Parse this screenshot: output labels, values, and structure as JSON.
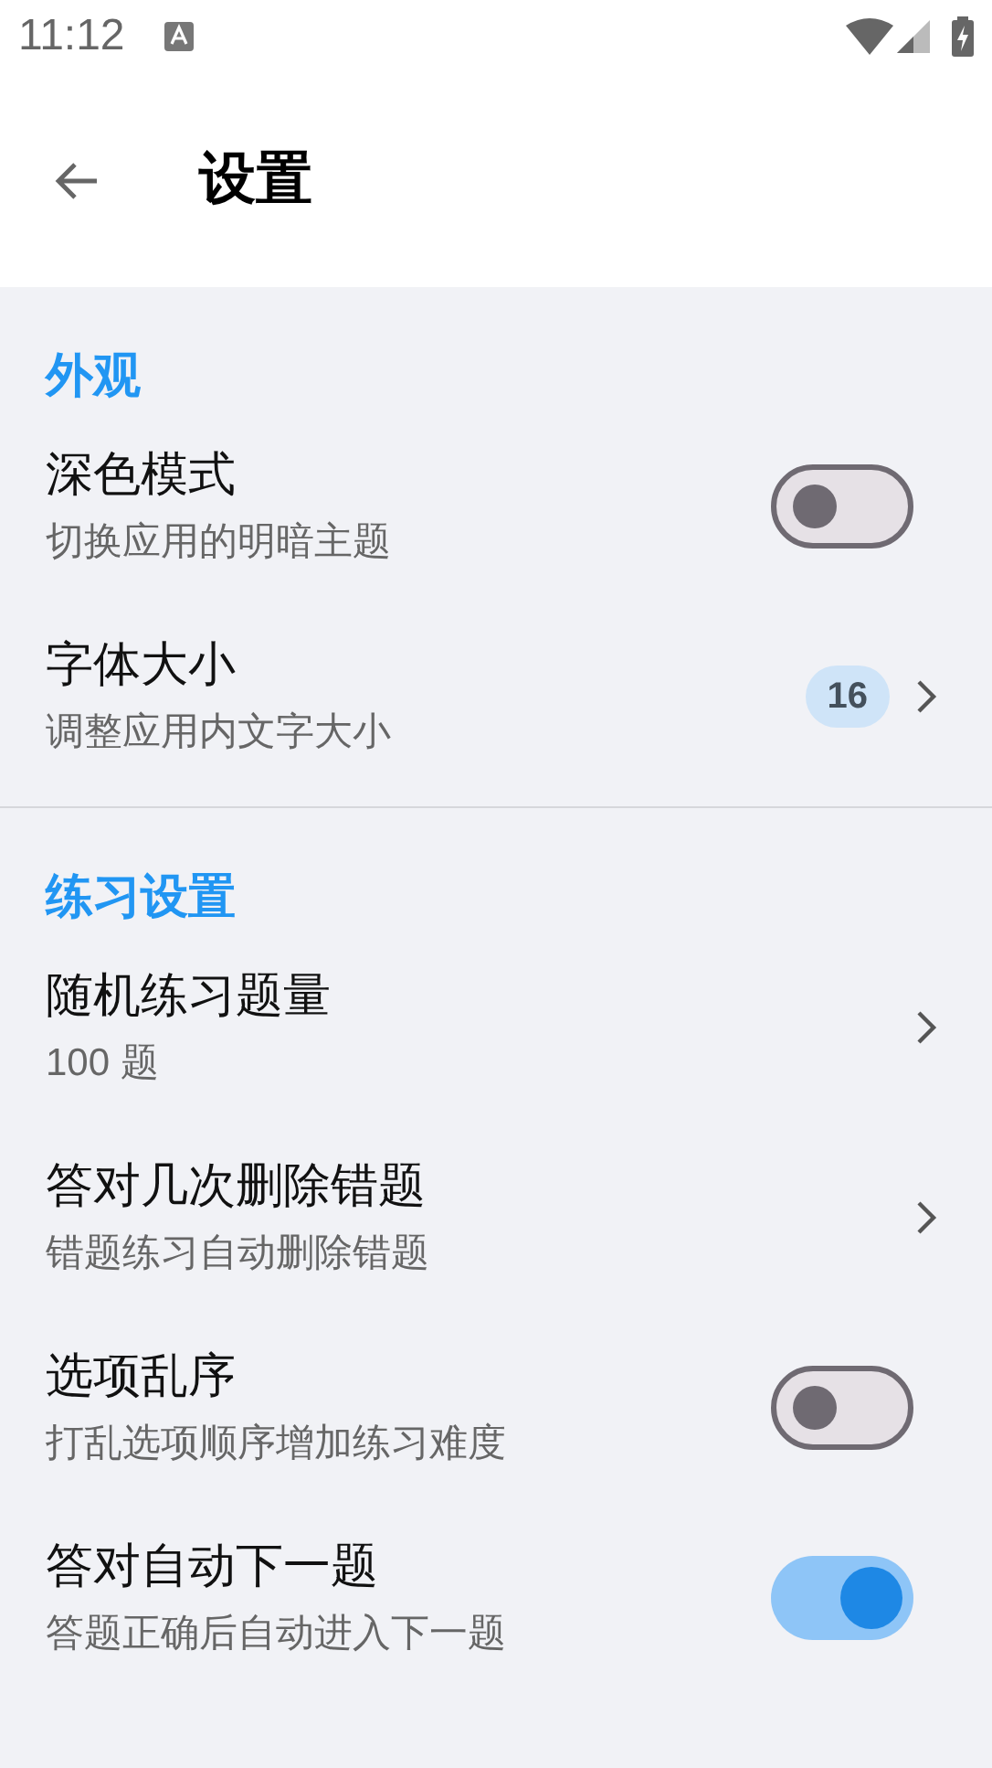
{
  "status_bar": {
    "time": "11:12"
  },
  "header": {
    "title": "设置"
  },
  "sections": [
    {
      "title": "外观",
      "items": [
        {
          "kind": "toggle",
          "title": "深色模式",
          "subtitle": "切换应用的明暗主题",
          "on": false
        },
        {
          "kind": "value",
          "title": "字体大小",
          "subtitle": "调整应用内文字大小",
          "value": "16"
        }
      ]
    },
    {
      "title": "练习设置",
      "items": [
        {
          "kind": "link",
          "title": "随机练习题量",
          "subtitle": "100 题"
        },
        {
          "kind": "link",
          "title": "答对几次删除错题",
          "subtitle": "错题练习自动删除错题"
        },
        {
          "kind": "toggle",
          "title": "选项乱序",
          "subtitle": "打乱选项顺序增加练习难度",
          "on": false
        },
        {
          "kind": "toggle",
          "title": "答对自动下一题",
          "subtitle": "答题正确后自动进入下一题",
          "on": true
        }
      ]
    }
  ]
}
